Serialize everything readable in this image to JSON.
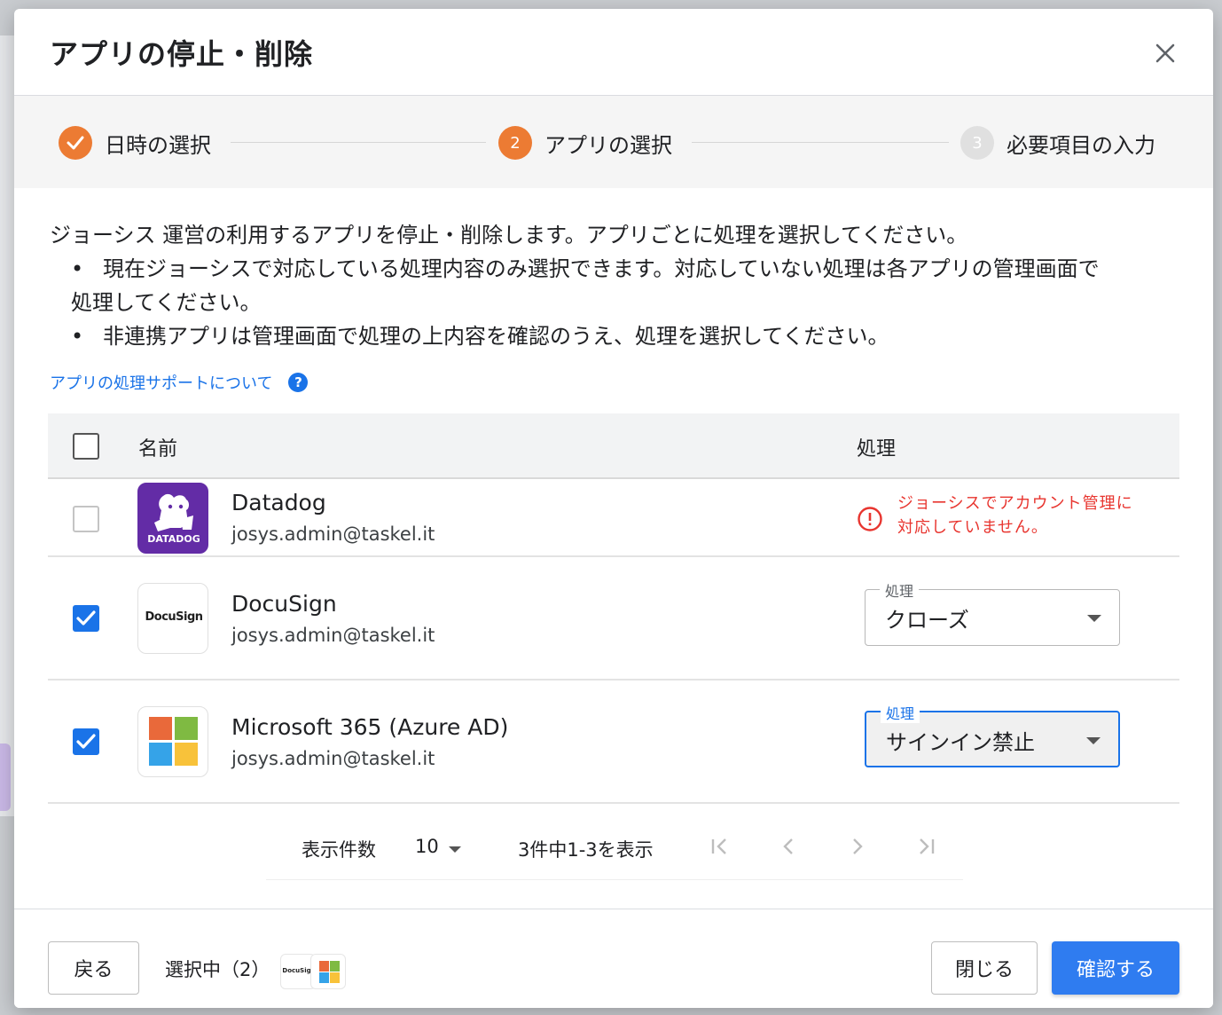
{
  "dialog": {
    "title": "アプリの停止・削除"
  },
  "stepper": {
    "steps": [
      {
        "number": "1",
        "label": "日時の選択",
        "state": "done"
      },
      {
        "number": "2",
        "label": "アプリの選択",
        "state": "active"
      },
      {
        "number": "3",
        "label": "必要項目の入力",
        "state": "pending"
      }
    ],
    "accent_color": "#ec7b33"
  },
  "description": {
    "intro": "ジョーシス 運営の利用するアプリを停止・削除します。アプリごとに処理を選択してください。",
    "bullets": [
      "現在ジョーシスで対応している処理内容のみ選択できます。対応していない処理は各アプリの管理画面で",
      "処理してください。",
      "非連携アプリは管理画面で処理の上内容を確認のうえ、処理を選択してください。"
    ]
  },
  "help_link": {
    "label": "アプリの処理サポートについて",
    "icon": "help-circle-icon"
  },
  "table": {
    "headers": {
      "name": "名前",
      "process": "処理"
    },
    "rows": [
      {
        "app": "Datadog",
        "email": "josys.admin@taskel.it",
        "checked": false,
        "disabled": true,
        "logo_text": "DATADOG",
        "warning": [
          "ジョーシスでアカウント管理に",
          "対応していません。"
        ]
      },
      {
        "app": "DocuSign",
        "email": "josys.admin@taskel.it",
        "checked": true,
        "logo_text": "DocuSign",
        "select_label": "処理",
        "select_value": "クローズ"
      },
      {
        "app": "Microsoft 365 (Azure AD)",
        "email": "josys.admin@taskel.it",
        "checked": true,
        "select_label": "処理",
        "select_value": "サインイン禁止",
        "focused": true
      }
    ]
  },
  "pagination": {
    "rows_label": "表示件数",
    "rows_per_page": "10",
    "range": "3件中1-3を表示"
  },
  "footer": {
    "back_label": "戻る",
    "selected_label": "選択中（2）",
    "close_label": "閉じる",
    "confirm_label": "確認する",
    "selected_logo_text": "DocuSign"
  },
  "colors": {
    "primary": "#2f7cf0",
    "link": "#1a73e8",
    "error": "#e8352f",
    "datadog": "#632ca6"
  }
}
